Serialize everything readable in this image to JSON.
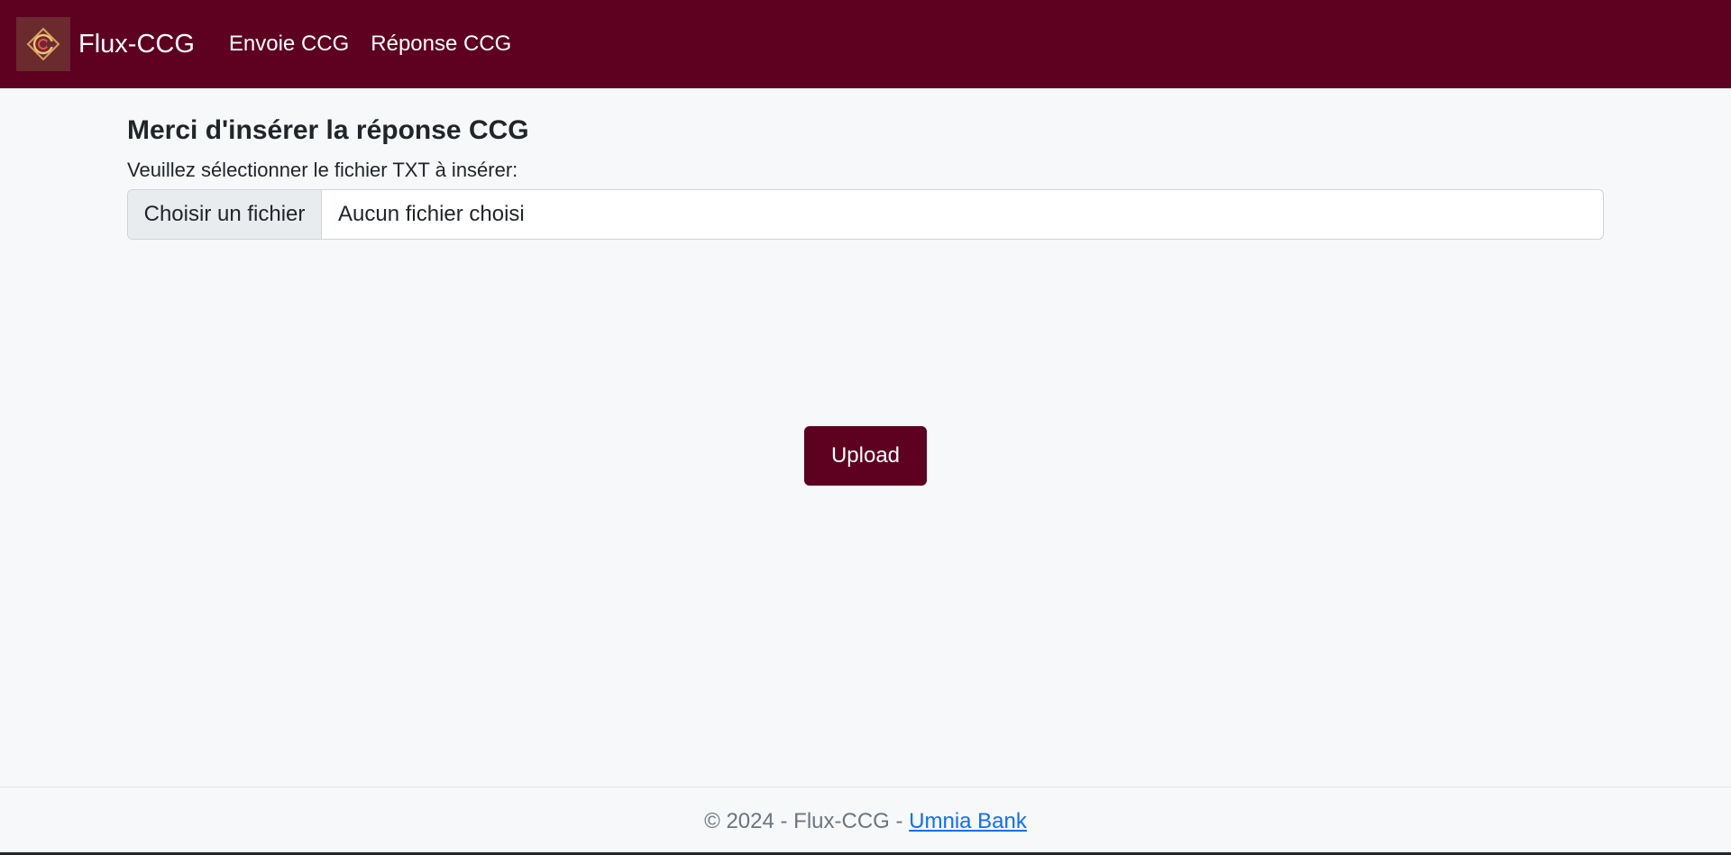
{
  "colors": {
    "brand": "#5e0020",
    "page_background": "#f7f8fa",
    "link": "#0d6efd"
  },
  "navbar": {
    "logo_icon": "ccg-logo-icon",
    "brand": "Flux-CCG",
    "links": [
      "Envoie CCG",
      "Réponse CCG"
    ]
  },
  "main": {
    "title": "Merci d'insérer la réponse CCG",
    "file_label": "Veuillez sélectionner le fichier TXT à insérer:",
    "file_button": "Choisir un fichier",
    "file_status": "Aucun fichier choisi",
    "upload_button": "Upload"
  },
  "footer": {
    "text": "© 2024 - Flux-CCG - ",
    "link": "Umnia Bank"
  }
}
